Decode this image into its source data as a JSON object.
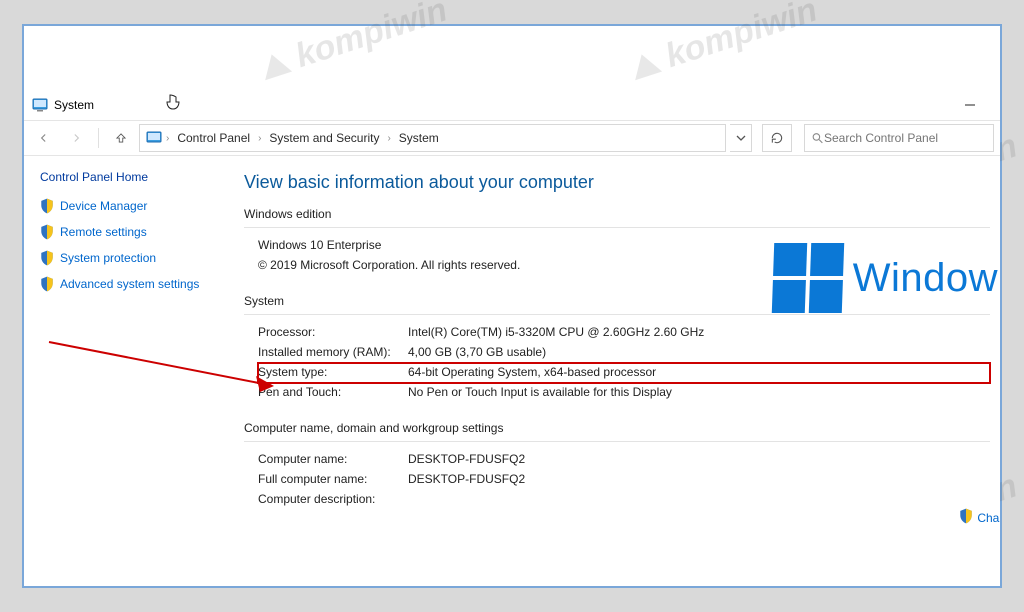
{
  "titlebar": {
    "title": "System"
  },
  "breadcrumb": {
    "items": [
      "Control Panel",
      "System and Security",
      "System"
    ]
  },
  "search": {
    "placeholder": "Search Control Panel"
  },
  "sidebar": {
    "home": "Control Panel Home",
    "items": [
      {
        "label": "Device Manager"
      },
      {
        "label": "Remote settings"
      },
      {
        "label": "System protection"
      },
      {
        "label": "Advanced system settings"
      }
    ]
  },
  "main": {
    "heading": "View basic information about your computer",
    "windows_edition": {
      "title": "Windows edition",
      "name": "Windows 10 Enterprise",
      "copyright": "© 2019 Microsoft Corporation. All rights reserved.",
      "brand": "Window"
    },
    "system": {
      "title": "System",
      "rows": [
        {
          "k": "Processor:",
          "v": "Intel(R) Core(TM) i5-3320M CPU @ 2.60GHz   2.60 GHz"
        },
        {
          "k": "Installed memory (RAM):",
          "v": "4,00 GB (3,70 GB usable)"
        },
        {
          "k": "System type:",
          "v": "64-bit Operating System, x64-based processor"
        },
        {
          "k": "Pen and Touch:",
          "v": "No Pen or Touch Input is available for this Display"
        }
      ]
    },
    "computer": {
      "title": "Computer name, domain and workgroup settings",
      "rows": [
        {
          "k": "Computer name:",
          "v": "DESKTOP-FDUSFQ2"
        },
        {
          "k": "Full computer name:",
          "v": "DESKTOP-FDUSFQ2"
        },
        {
          "k": "Computer description:",
          "v": ""
        }
      ],
      "change": "Chan"
    }
  },
  "watermark": "kompiwin"
}
